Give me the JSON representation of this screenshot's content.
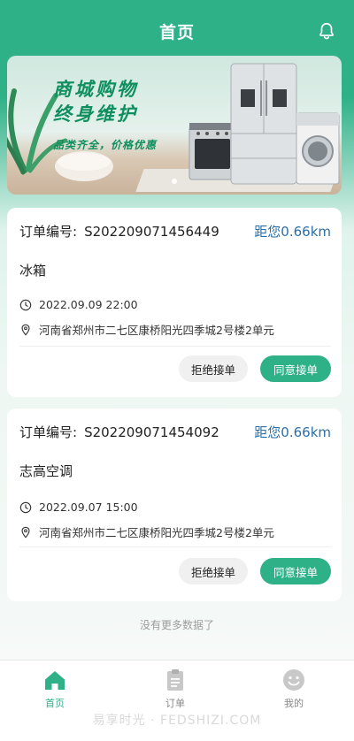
{
  "header": {
    "title": "首页"
  },
  "banner": {
    "slogan_line1": "商城购物",
    "slogan_line2": "终身维护",
    "subline": "品类齐全，价格优惠"
  },
  "orders": [
    {
      "order_label": "订单编号:",
      "order_no": "S202209071456449",
      "distance": "距您0.66km",
      "product": "冰箱",
      "datetime": "2022.09.09 22:00",
      "address": "河南省郑州市二七区康桥阳光四季城2号楼2单元",
      "reject_label": "拒绝接单",
      "accept_label": "同意接单"
    },
    {
      "order_label": "订单编号:",
      "order_no": "S202209071454092",
      "distance": "距您0.66km",
      "product": "志高空调",
      "datetime": "2022.09.07 15:00",
      "address": "河南省郑州市二七区康桥阳光四季城2号楼2单元",
      "reject_label": "拒绝接单",
      "accept_label": "同意接单"
    }
  ],
  "list_footer": "没有更多数据了",
  "tabbar": {
    "items": [
      {
        "label": "首页",
        "icon": "home-icon",
        "active": true
      },
      {
        "label": "订单",
        "icon": "clipboard-icon",
        "active": false
      },
      {
        "label": "我的",
        "icon": "smiley-icon",
        "active": false
      }
    ]
  },
  "watermark": "易享时光 · FEDSHIZI.COM",
  "colors": {
    "accent": "#2eb187",
    "distance": "#2b6fa8",
    "muted": "#9c9c9c"
  }
}
